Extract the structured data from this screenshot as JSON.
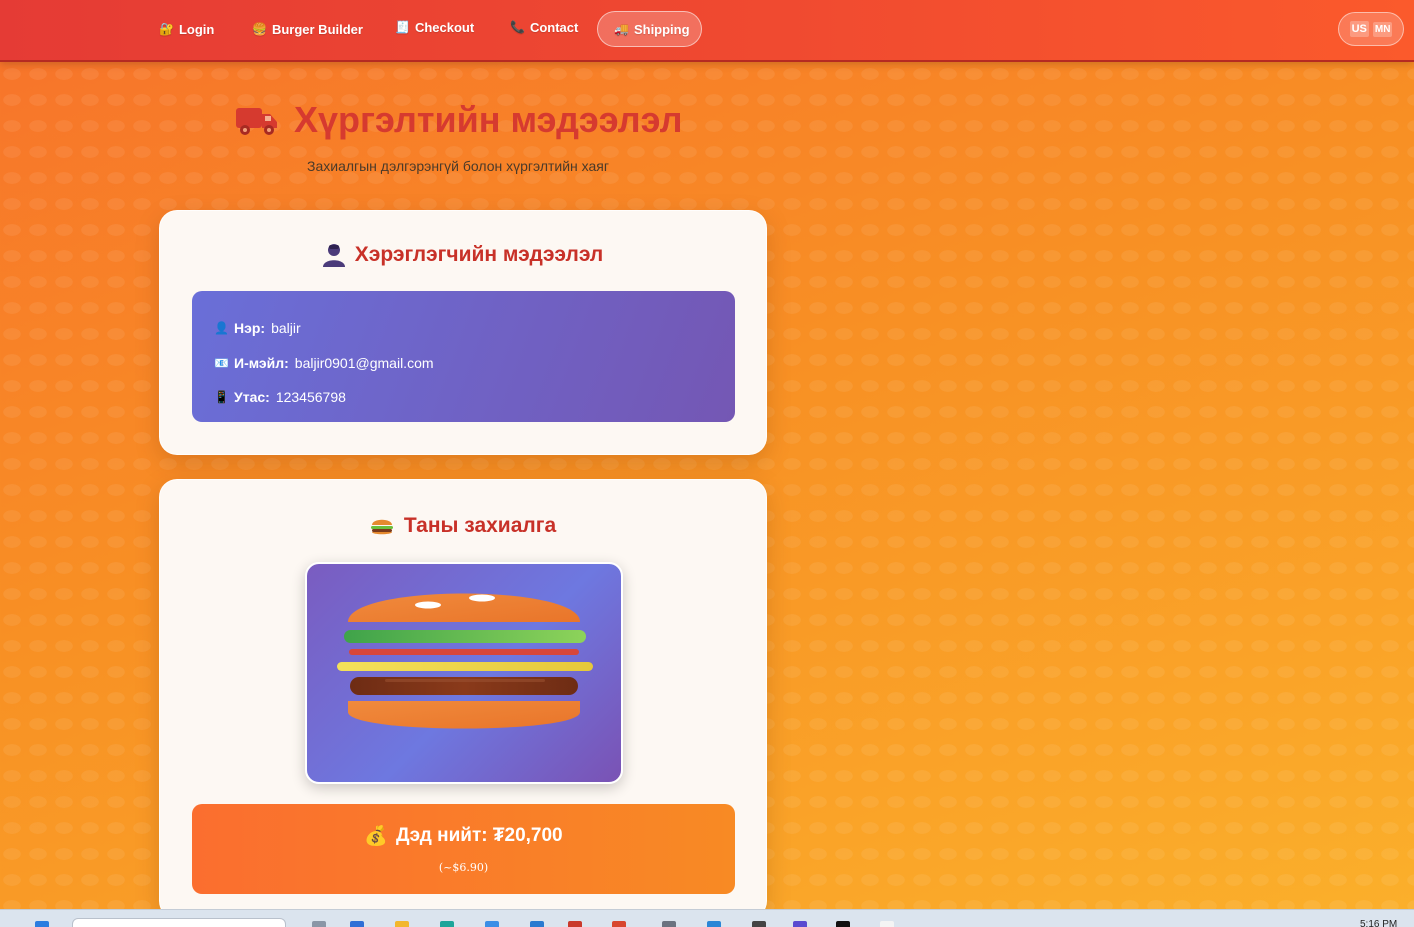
{
  "nav": {
    "items": [
      {
        "label": "Login",
        "icon": "lock-icon",
        "glyph": "🔐"
      },
      {
        "label": "Burger Builder",
        "icon": "burger-icon",
        "glyph": "🍔"
      },
      {
        "label": "Checkout",
        "icon": "receipt-icon",
        "glyph": "🧾"
      },
      {
        "label": "Contact",
        "icon": "phone-icon",
        "glyph": "📞"
      },
      {
        "label": "Shipping",
        "icon": "truck-icon",
        "glyph": "🚚"
      }
    ],
    "active": "Shipping",
    "lang": {
      "us": "US",
      "mn": "MN"
    }
  },
  "header": {
    "title": "Хүргэлтийн мэдээлэл",
    "subtitle": "Захиалгын дэлгэрэнгүй болон хүргэлтийн хаяг"
  },
  "user_card": {
    "title": "Хэрэглэгчийн мэдээлэл",
    "rows": [
      {
        "label": "Нэр:",
        "value": "baljir",
        "icon": "person-icon",
        "glyph": "👤"
      },
      {
        "label": "И-мэйл:",
        "value": "baljir0901@gmail.com",
        "icon": "email-icon",
        "glyph": "📧"
      },
      {
        "label": "Утас:",
        "value": "123456798",
        "icon": "phone-icon",
        "glyph": "📱"
      }
    ]
  },
  "order_card": {
    "title": "Таны захиалга",
    "total_label": "Дэд нийт: ₮20,700",
    "total_usd": "(~$6.90)"
  },
  "taskbar": {
    "time": "5:16 PM"
  },
  "colors": {
    "accent": "#d63a2f",
    "navbar": "#f04a30",
    "user_box": "#6e64c8",
    "total_box": "#f97d2a"
  }
}
